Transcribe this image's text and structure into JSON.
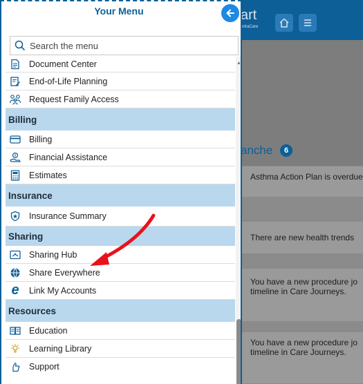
{
  "app": {
    "logo": "art",
    "logo_sub": "ntraCare",
    "greeting": "anche",
    "greeting_count": "6",
    "cards": [
      "Asthma Action Plan is overdue",
      "There are new health trends",
      "You have a new procedure jo timeline in Care Journeys.",
      "You have a new procedure jo timeline in Care Journeys."
    ]
  },
  "menu": {
    "title": "Your Menu",
    "search_placeholder": "Search the menu",
    "groups": {
      "top_items": [
        {
          "label": "Document Center",
          "icon": "document-icon"
        },
        {
          "label": "End-of-Life Planning",
          "icon": "form-edit-icon"
        },
        {
          "label": "Request Family Access",
          "icon": "family-icon"
        }
      ],
      "billing": {
        "label": "Billing",
        "items": [
          {
            "label": "Billing",
            "icon": "credit-card-icon"
          },
          {
            "label": "Financial Assistance",
            "icon": "hand-money-icon"
          },
          {
            "label": "Estimates",
            "icon": "calculator-icon"
          }
        ]
      },
      "insurance": {
        "label": "Insurance",
        "items": [
          {
            "label": "Insurance Summary",
            "icon": "shield-icon"
          }
        ]
      },
      "sharing": {
        "label": "Sharing",
        "items": [
          {
            "label": "Sharing Hub",
            "icon": "sharing-hub-icon"
          },
          {
            "label": "Share Everywhere",
            "icon": "globe-share-icon"
          },
          {
            "label": "Link My Accounts",
            "icon": "link-accounts-icon"
          }
        ]
      },
      "resources": {
        "label": "Resources",
        "items": [
          {
            "label": "Education",
            "icon": "book-icon"
          },
          {
            "label": "Learning Library",
            "icon": "lightbulb-icon"
          },
          {
            "label": "Support",
            "icon": "support-icon"
          }
        ]
      }
    }
  },
  "colors": {
    "brand": "#0d5f97",
    "section_bg": "#b9d8ee",
    "annotation_arrow": "#e8121b"
  }
}
